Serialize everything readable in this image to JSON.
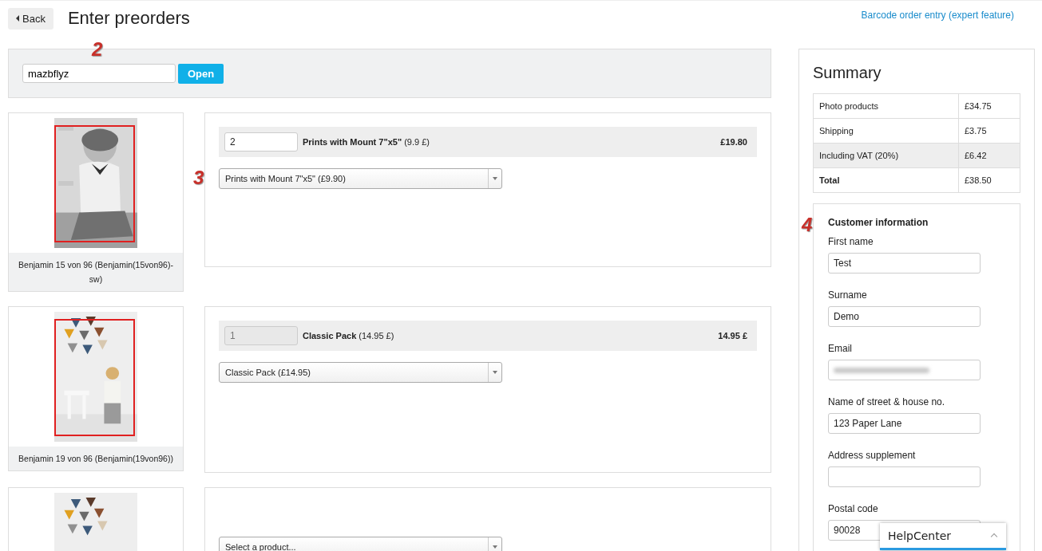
{
  "header": {
    "back_label": "Back",
    "title": "Enter preorders",
    "link": "Barcode order entry (expert feature)"
  },
  "order_search": {
    "value": "mazbflyz",
    "button": "Open",
    "annotation": "2"
  },
  "items": [
    {
      "caption": "Benjamin 15 von 96 (Benjamin(15von96)-sw)",
      "annotation": "3",
      "crop_frame": true,
      "line": {
        "quantity": "2",
        "quantity_disabled": false,
        "product": "**Prints with Mount 7\"x5\"** (9.9 £)",
        "total": "£19.80"
      },
      "select": {
        "value": "Prints with Mount 7\"x5\" (£9.90)"
      }
    },
    {
      "caption": "Benjamin 19 von 96 (Benjamin(19von96))",
      "crop_frame": true,
      "line": {
        "quantity": "1",
        "quantity_disabled": true,
        "product": "**Classic Pack** (14.95 £)",
        "total": "14.95 £"
      },
      "select": {
        "value": "Classic Pack (£14.95)"
      }
    },
    {
      "crop_frame": false,
      "select": {
        "placeholder": "Select a product..."
      }
    }
  ],
  "summary": {
    "title": "Summary",
    "rows": [
      {
        "label": "Photo products",
        "value": "£34.75",
        "highlighted": false,
        "bold": false
      },
      {
        "label": "Shipping",
        "value": "£3.75",
        "highlighted": false,
        "bold": false
      },
      {
        "label": "Including VAT (20%)",
        "value": "£6.42",
        "highlighted": true,
        "bold": false
      },
      {
        "label": "Total",
        "value": "£38.50",
        "highlighted": false,
        "bold": true
      }
    ]
  },
  "customer": {
    "title": "Customer information",
    "annotation": "4",
    "fields": [
      {
        "label": "First name",
        "value": "Test",
        "kind": "text"
      },
      {
        "label": "Surname",
        "value": "Demo",
        "kind": "text"
      },
      {
        "label": "Email",
        "kind": "blurred"
      },
      {
        "label": "Name of street & house no.",
        "value": "123 Paper Lane",
        "kind": "text"
      },
      {
        "label": "Address supplement",
        "kind": "text"
      },
      {
        "label": "Postal code",
        "value": "90028",
        "kind": "text"
      }
    ]
  },
  "help_widget": {
    "label": "HelpCenter",
    "expanded": false
  }
}
